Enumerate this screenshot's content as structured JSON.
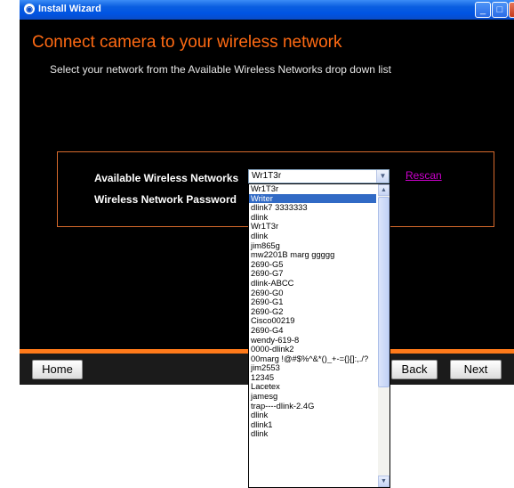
{
  "window": {
    "title": "Install Wizard",
    "minimize_glyph": "_",
    "maximize_glyph": "□",
    "close_glyph": "×"
  },
  "page": {
    "heading": "Connect camera to your wireless network",
    "subheading": "Select your network from the Available Wireless Networks drop down list"
  },
  "form": {
    "networks_label": "Available Wireless Networks",
    "password_label": "Wireless Network Password",
    "selected_network": "Wr1T3r",
    "rescan_label": "Rescan"
  },
  "dropdown": {
    "options": [
      "Wr1T3r",
      "Writer",
      "dlink7 3333333",
      "dlink",
      "Wr1T3r",
      "dlink",
      "jim865g",
      "mw2201B marg  ggggg",
      "2690-G5",
      "2690-G7",
      "dlink-ABCC",
      "2690-G0",
      "2690-G1",
      "2690-G2",
      "Cisco00219",
      "2690-G4",
      "wendy-619-8",
      "0000-dlink2",
      "00marg !@#$%^&*()_+-={}[]:,./?",
      "jim2553",
      "12345",
      "Lacetex",
      "jamesg",
      "trap----dlink-2.4G",
      "dlink",
      "dlink1",
      "dlink"
    ],
    "highlighted_index": 1
  },
  "footer": {
    "home_label": "Home",
    "back_label": "Back",
    "next_label": "Next"
  },
  "colors": {
    "accent": "#ff6a13",
    "link": "#cc00cc",
    "selection": "#316ac5",
    "titlebar": "#0054e3"
  },
  "icons": {
    "app": "wizard-icon",
    "scroll_up": "scroll-up-arrow",
    "scroll_down": "scroll-down-arrow",
    "select_arrow": "dropdown-arrow"
  }
}
